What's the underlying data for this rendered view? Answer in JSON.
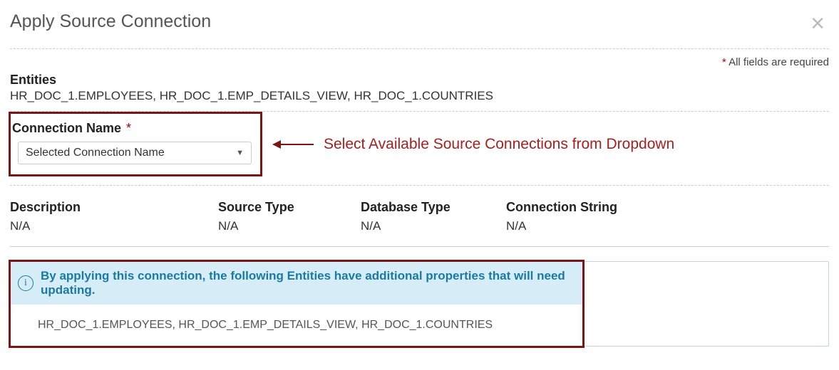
{
  "dialog": {
    "title": "Apply Source Connection",
    "required_note_prefix": "*",
    "required_note_text": " All fields are required",
    "close_glyph": "×"
  },
  "entities": {
    "label": "Entities",
    "value": "HR_DOC_1.EMPLOYEES, HR_DOC_1.EMP_DETAILS_VIEW, HR_DOC_1.COUNTRIES"
  },
  "connection": {
    "label": "Connection Name",
    "required_mark": "*",
    "dropdown_value": "Selected Connection Name",
    "dropdown_caret": "▼"
  },
  "annotation": {
    "text": "Select Available Source Connections from Dropdown"
  },
  "details": {
    "description": {
      "label": "Description",
      "value": "N/A"
    },
    "source_type": {
      "label": "Source Type",
      "value": "N/A"
    },
    "database_type": {
      "label": "Database Type",
      "value": "N/A"
    },
    "connection_string": {
      "label": "Connection String",
      "value": "N/A"
    }
  },
  "info": {
    "icon_glyph": "i",
    "message": "By applying this connection, the following Entities have additional properties that will need updating.",
    "entities": "HR_DOC_1.EMPLOYEES, HR_DOC_1.EMP_DETAILS_VIEW, HR_DOC_1.COUNTRIES"
  }
}
